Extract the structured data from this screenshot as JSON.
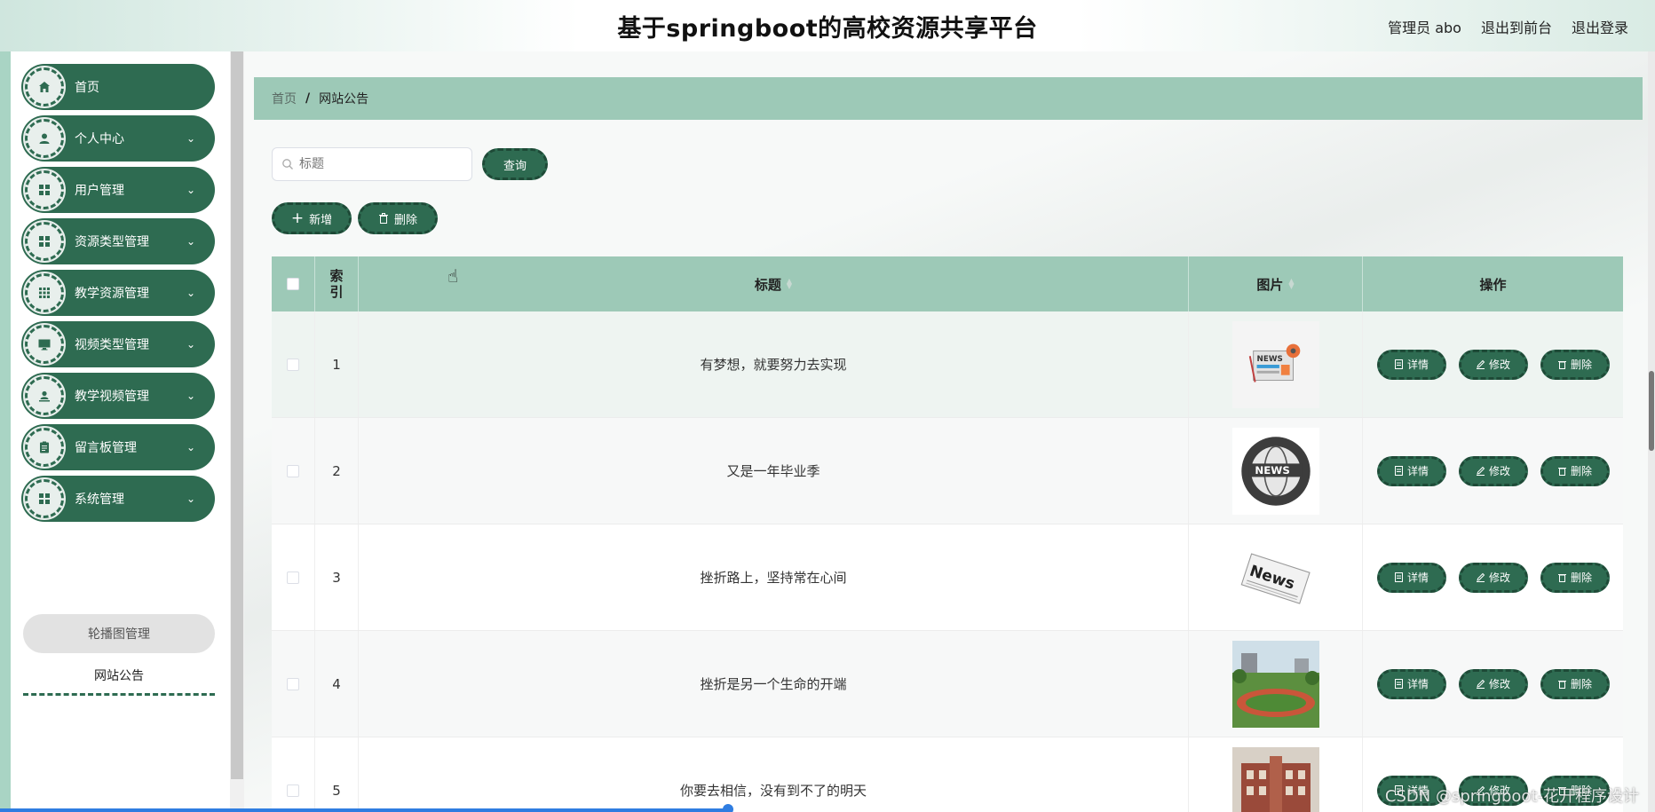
{
  "header": {
    "title": "基于springboot的高校资源共享平台",
    "user_label": "管理员 abo",
    "back_label": "退出到前台",
    "logout_label": "退出登录"
  },
  "sidebar": {
    "items": [
      {
        "label": "首页",
        "icon": "home-icon",
        "expandable": false
      },
      {
        "label": "个人中心",
        "icon": "user-icon",
        "expandable": true
      },
      {
        "label": "用户管理",
        "icon": "grid-icon",
        "expandable": true
      },
      {
        "label": "资源类型管理",
        "icon": "grid-icon",
        "expandable": true
      },
      {
        "label": "教学资源管理",
        "icon": "apps-icon",
        "expandable": true
      },
      {
        "label": "视频类型管理",
        "icon": "monitor-icon",
        "expandable": true
      },
      {
        "label": "教学视频管理",
        "icon": "user-card-icon",
        "expandable": true
      },
      {
        "label": "留言板管理",
        "icon": "clipboard-icon",
        "expandable": true
      },
      {
        "label": "系统管理",
        "icon": "grid-icon",
        "expandable": true
      }
    ],
    "submenu": [
      "轮播图管理",
      "网站公告"
    ]
  },
  "breadcrumb": {
    "home": "首页",
    "separator": "/",
    "current": "网站公告"
  },
  "search": {
    "placeholder": "标题",
    "button": "查询"
  },
  "actions": {
    "add": "新增",
    "delete": "删除"
  },
  "table": {
    "columns": {
      "index": "索",
      "index2": "引",
      "title": "标题",
      "image": "图片",
      "ops": "操作"
    },
    "ops_labels": {
      "detail": "详情",
      "edit": "修改",
      "delete": "删除"
    },
    "rows": [
      {
        "index": "1",
        "title": "有梦想，就要努力去实现",
        "image": "news-paper-icon"
      },
      {
        "index": "2",
        "title": "又是一年毕业季",
        "image": "news-globe-icon"
      },
      {
        "index": "3",
        "title": "挫折路上，坚持常在心间",
        "image": "newspaper-icon"
      },
      {
        "index": "4",
        "title": "挫折是另一个生命的开端",
        "image": "campus-photo"
      },
      {
        "index": "5",
        "title": "你要去相信，没有到不了的明天",
        "image": "building-photo"
      }
    ]
  },
  "watermark": "CSDN @springboot-花开程序设计",
  "colors": {
    "primary": "#2e6b51",
    "header_row": "#9dc9b7",
    "sidebar_bg": "#a9d4c4"
  }
}
